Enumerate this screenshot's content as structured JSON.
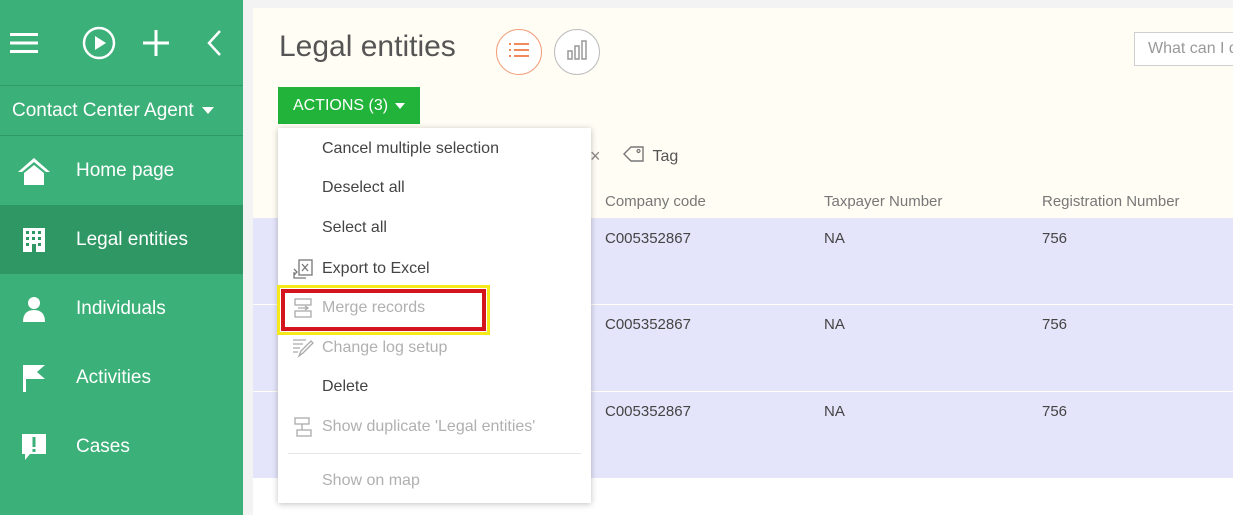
{
  "sidebar": {
    "role_label": "Contact Center Agent",
    "items": [
      {
        "label": "Home page",
        "icon": "home-icon"
      },
      {
        "label": "Legal entities",
        "icon": "building-icon",
        "active": true
      },
      {
        "label": "Individuals",
        "icon": "person-icon"
      },
      {
        "label": "Activities",
        "icon": "flag-icon"
      },
      {
        "label": "Cases",
        "icon": "exclamation-icon"
      }
    ]
  },
  "header": {
    "title": "Legal entities",
    "search_placeholder": "What can I d"
  },
  "toolbar": {
    "actions_label": "ACTIONS (3)",
    "tag_label": "Tag"
  },
  "table": {
    "columns": [
      "Company code",
      "Taxpayer Number",
      "Registration Number"
    ],
    "rows": [
      [
        "C005352867",
        "NA",
        "756"
      ],
      [
        "C005352867",
        "NA",
        "756"
      ],
      [
        "C005352867",
        "NA",
        "756"
      ]
    ]
  },
  "actions_menu": {
    "items": [
      {
        "label": "Cancel multiple selection",
        "enabled": true
      },
      {
        "label": "Deselect all",
        "enabled": true
      },
      {
        "label": "Select all",
        "enabled": true
      },
      {
        "label": "Export to Excel",
        "enabled": true,
        "icon": "excel-export-icon"
      },
      {
        "label": "Merge records",
        "enabled": false,
        "icon": "merge-icon"
      },
      {
        "label": "Change log setup",
        "enabled": false,
        "icon": "change-log-icon"
      },
      {
        "label": "Delete",
        "enabled": true
      },
      {
        "label": "Show duplicate 'Legal entities'",
        "enabled": false,
        "icon": "duplicate-icon"
      },
      {
        "label": "Show on map",
        "enabled": false
      }
    ]
  },
  "colors": {
    "sidebar_bg": "#3bb078",
    "sidebar_active": "#2e9764",
    "actions_button": "#22b33a",
    "selected_row": "#e4e5fa",
    "highlight_outer": "#f5e81b",
    "highlight_inner": "#d4151e"
  }
}
